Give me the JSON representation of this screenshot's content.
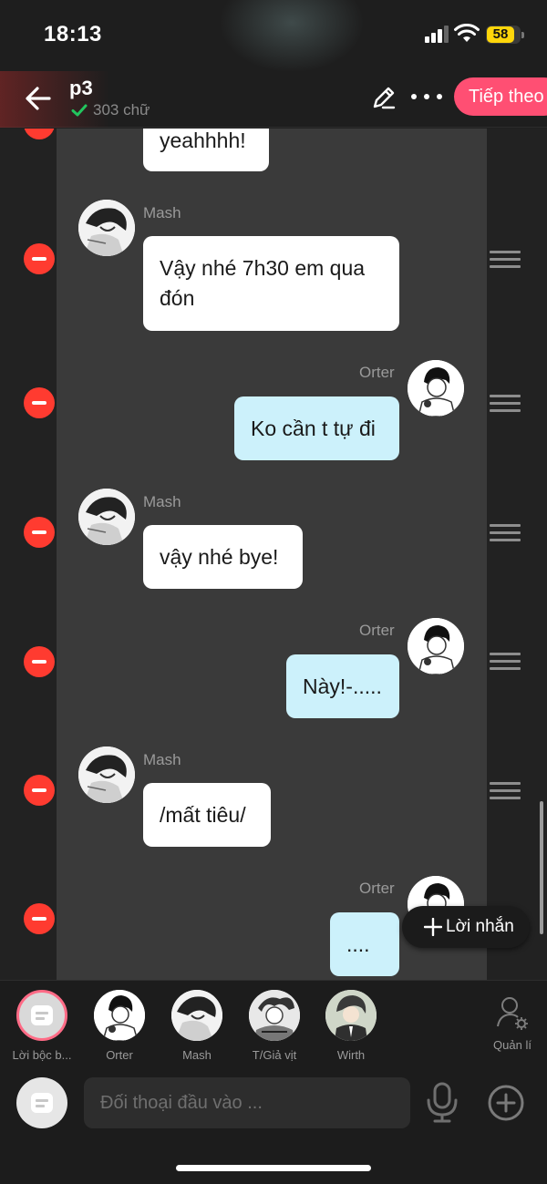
{
  "status_bar": {
    "time": "18:13",
    "battery": "58"
  },
  "header": {
    "title": "p3",
    "word_count": "303 chữ",
    "next_label": "Tiếp theo"
  },
  "messages": [
    {
      "side": "left",
      "sender": "",
      "text": "yeahhhh!"
    },
    {
      "side": "left",
      "sender": "Mash",
      "text": "Vậy nhé 7h30 em qua đón"
    },
    {
      "side": "right",
      "sender": "Orter",
      "text": "Ko cần t tự đi"
    },
    {
      "side": "left",
      "sender": "Mash",
      "text": "vậy nhé bye!"
    },
    {
      "side": "right",
      "sender": "Orter",
      "text": "Này!-....."
    },
    {
      "side": "left",
      "sender": "Mash",
      "text": "/mất tiêu/"
    },
    {
      "side": "right",
      "sender": "Orter",
      "text": "...."
    }
  ],
  "add_message_label": "Lời nhắn",
  "characters": [
    {
      "name": "Lời bộc b...",
      "selected": true
    },
    {
      "name": "Orter"
    },
    {
      "name": "Mash"
    },
    {
      "name": "T/Giả vịt"
    },
    {
      "name": "Wirth"
    }
  ],
  "manage_label": "Quản lí",
  "input": {
    "placeholder": "Đối thoại đầu vào ..."
  },
  "colors": {
    "accent": "#ff4f73",
    "delete": "#ff3b30",
    "bubble_right": "#ccf1fb",
    "bubble_left": "#ffffff"
  }
}
